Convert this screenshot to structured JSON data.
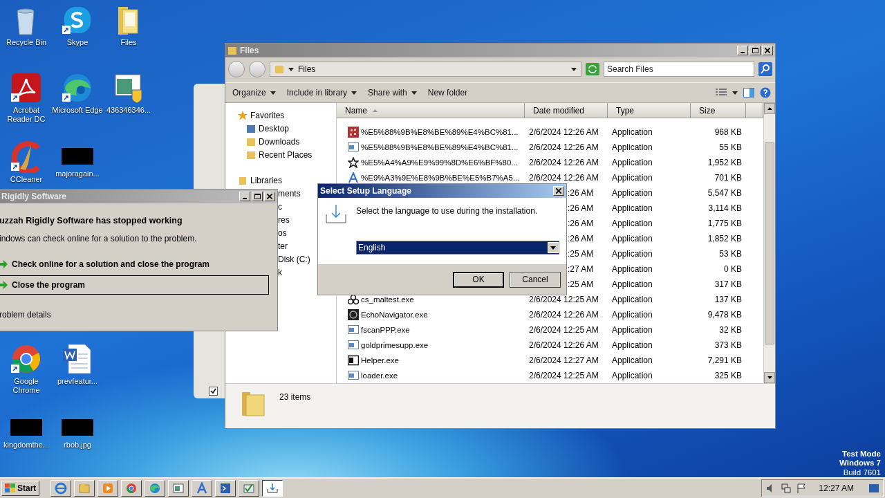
{
  "desktop_icons": [
    {
      "label": "Recycle Bin",
      "kind": "bin",
      "shortcut": false
    },
    {
      "label": "Skype",
      "kind": "skype",
      "shortcut": true
    },
    {
      "label": "Files",
      "kind": "folder",
      "shortcut": false
    },
    {
      "label": "Acrobat Reader DC",
      "kind": "acrobat",
      "shortcut": true
    },
    {
      "label": "Microsoft Edge",
      "kind": "edge",
      "shortcut": true
    },
    {
      "label": "436346346...",
      "kind": "installer",
      "shortcut": false
    },
    {
      "label": "CCleaner",
      "kind": "ccleaner",
      "shortcut": true
    },
    {
      "label": "majoragain...",
      "kind": "redacted"
    },
    {
      "label": "Google Chrome",
      "kind": "chrome",
      "shortcut": true
    },
    {
      "label": "prevfeatur...",
      "kind": "word",
      "shortcut": false
    },
    {
      "label": "kingdomthe...",
      "kind": "redacted"
    },
    {
      "label": "rbob.jpg",
      "kind": "redacted"
    }
  ],
  "explorer": {
    "title": "Files",
    "address": "Files",
    "search": {
      "placeholder": "Search Files"
    },
    "toolbar": [
      {
        "label": "Organize",
        "dropdown": true
      },
      {
        "label": "Include in library",
        "dropdown": true
      },
      {
        "label": "Share with",
        "dropdown": true
      },
      {
        "label": "New folder",
        "dropdown": false
      }
    ],
    "nav": [
      {
        "label": "Favorites",
        "kind": "group"
      },
      {
        "label": "Desktop",
        "kind": "item"
      },
      {
        "label": "Downloads",
        "kind": "item"
      },
      {
        "label": "Recent Places",
        "kind": "item"
      },
      {
        "label": "Libraries",
        "kind": "group"
      },
      {
        "label": "ments",
        "kind": "partial"
      },
      {
        "label": "c",
        "kind": "partial"
      },
      {
        "label": "res",
        "kind": "partial"
      },
      {
        "label": "os",
        "kind": "partial"
      },
      {
        "label": "ter",
        "kind": "partial"
      },
      {
        "label": "Disk (C:)",
        "kind": "partial"
      },
      {
        "label": "k",
        "kind": "partial"
      }
    ],
    "columns": [
      {
        "label": "Name",
        "sorted": true
      },
      {
        "label": "Date modified",
        "sorted": false
      },
      {
        "label": "Type",
        "sorted": false
      },
      {
        "label": "Size",
        "sorted": false
      }
    ],
    "rows": [
      {
        "name": "%E5%88%9B%E8%BE%89%E4%BC%81...",
        "date": "2/6/2024 12:26 AM",
        "type": "Application",
        "size": "968 KB"
      },
      {
        "name": "%E5%88%9B%E8%BE%89%E4%BC%81...",
        "date": "2/6/2024 12:26 AM",
        "type": "Application",
        "size": "55 KB"
      },
      {
        "name": "%E5%A4%A9%E9%99%8D%E6%BF%80...",
        "date": "2/6/2024 12:26 AM",
        "type": "Application",
        "size": "1,952 KB"
      },
      {
        "name": "%E9%A3%9E%E8%9B%BE%E5%B7%A5...",
        "date": "2/6/2024 12:26 AM",
        "type": "Application",
        "size": "701 KB"
      },
      {
        "date": ":26 AM",
        "type": "Application",
        "size": "5,547 KB"
      },
      {
        "date": ":26 AM",
        "type": "Application",
        "size": "3,114 KB"
      },
      {
        "date": ":26 AM",
        "type": "Application",
        "size": "1,775 KB"
      },
      {
        "date": ":26 AM",
        "type": "Application",
        "size": "1,852 KB"
      },
      {
        "date": ":25 AM",
        "type": "Application",
        "size": "53 KB"
      },
      {
        "date": ":27 AM",
        "type": "Application",
        "size": "0 KB"
      },
      {
        "date": ":25 AM",
        "type": "Application",
        "size": "317 KB"
      },
      {
        "name": "cs_maltest.exe",
        "date": "2/6/2024 12:25 AM",
        "type": "Application",
        "size": "137 KB"
      },
      {
        "name": "EchoNavigator.exe",
        "date": "2/6/2024 12:26 AM",
        "type": "Application",
        "size": "9,478 KB"
      },
      {
        "name": "fscanPPP.exe",
        "date": "2/6/2024 12:25 AM",
        "type": "Application",
        "size": "32 KB"
      },
      {
        "name": "goldprimesupp.exe",
        "date": "2/6/2024 12:26 AM",
        "type": "Application",
        "size": "373 KB"
      },
      {
        "name": "Helper.exe",
        "date": "2/6/2024 12:27 AM",
        "type": "Application",
        "size": "7,291 KB"
      },
      {
        "name": "loader.exe",
        "date": "2/6/2024 12:25 AM",
        "type": "Application",
        "size": "325 KB"
      }
    ],
    "status": "23 items"
  },
  "crash_dialog": {
    "title": "Rigidly Software",
    "heading": "uzzah Rigidly Software has stopped working",
    "message": "indows can check online for a solution to the problem.",
    "options": [
      {
        "label": "Check online for a solution and close the program",
        "selected": false
      },
      {
        "label": "Close the program",
        "selected": true
      }
    ],
    "details": "roblem details"
  },
  "language_dialog": {
    "title": "Select Setup Language",
    "message": "Select the language to use during the installation.",
    "language": "English",
    "buttons": [
      {
        "label": "OK",
        "default": true
      },
      {
        "label": "Cancel",
        "default": false
      }
    ]
  },
  "background_window": {
    "checked": true
  },
  "os_notice": [
    "Test Mode",
    "Windows 7",
    "Build 7601"
  ],
  "taskbar": {
    "start": "Start",
    "apps": [
      {
        "selected": false
      },
      {
        "selected": false
      },
      {
        "selected": false
      },
      {
        "selected": false
      },
      {
        "selected": false
      },
      {
        "selected": false
      },
      {
        "selected": false
      },
      {
        "selected": false
      },
      {
        "selected": false
      },
      {
        "selected": true
      }
    ],
    "clock": "12:27 AM"
  }
}
